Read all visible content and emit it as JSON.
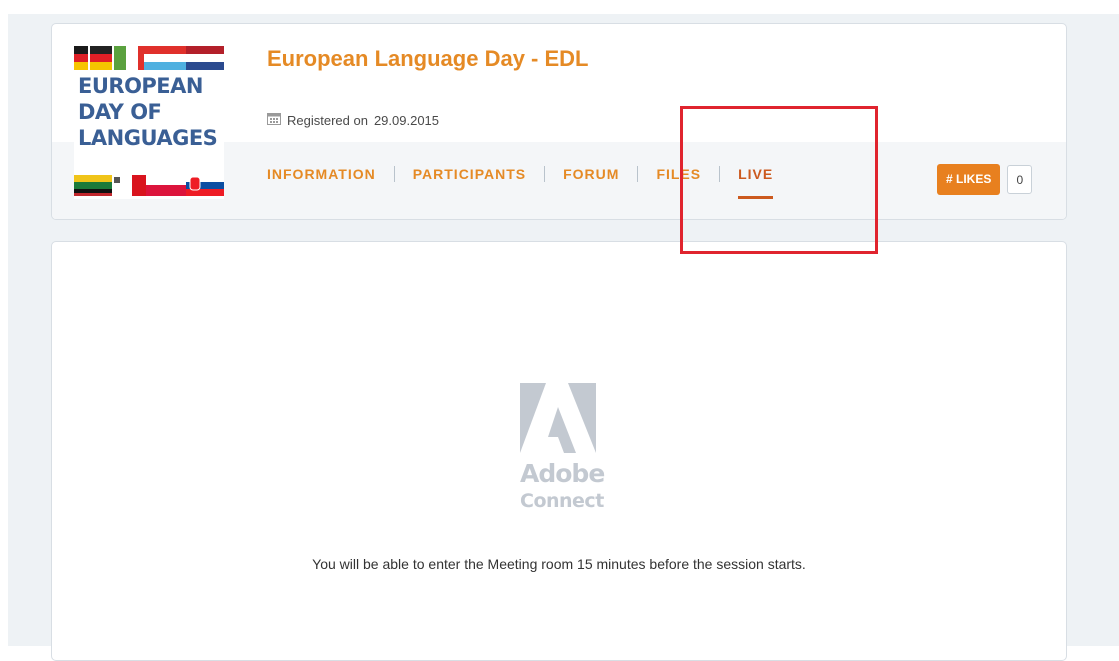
{
  "event": {
    "title": "European Language Day - EDL",
    "registered_label": "Registered on",
    "registered_date": "29.09.2015",
    "logo_text": [
      "EUROPEAN",
      "DAY OF",
      "LANGUAGES"
    ]
  },
  "tabs": [
    {
      "label": "INFORMATION",
      "active": false
    },
    {
      "label": "PARTICIPANTS",
      "active": false
    },
    {
      "label": "FORUM",
      "active": false
    },
    {
      "label": "FILES",
      "active": false
    },
    {
      "label": "LIVE",
      "active": true
    }
  ],
  "likes": {
    "label": "# LIKES",
    "count": "0"
  },
  "live": {
    "product_name_1": "Adobe",
    "product_name_2": "Connect",
    "message": "You will be able to enter the Meeting room 15 minutes before the session starts."
  },
  "colors": {
    "accent": "#e58a25",
    "active_tab": "#cc5a1f",
    "likes_button": "#e8801f",
    "highlight": "#e0242e"
  },
  "icons": {
    "registered": "calendar-icon",
    "live_logo": "adobe-connect-icon"
  }
}
